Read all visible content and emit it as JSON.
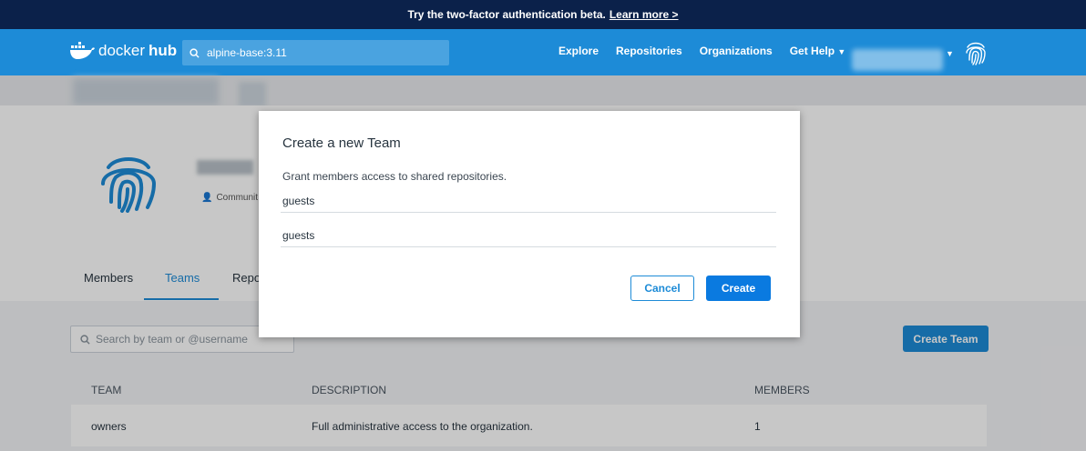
{
  "banner": {
    "text": "Try the two-factor authentication beta.",
    "link": "Learn more >"
  },
  "nav": {
    "logo_text_a": "docker",
    "logo_text_b": "hub",
    "search_value": "alpine-base:3.11",
    "links": [
      "Explore",
      "Repositories",
      "Organizations",
      "Get Help"
    ]
  },
  "org": {
    "type_label": "Communit"
  },
  "tabs": [
    "Members",
    "Teams",
    "Repos"
  ],
  "team_search": {
    "placeholder": "Search by team or @username"
  },
  "create_team_label": "Create Team",
  "table": {
    "headers": [
      "TEAM",
      "DESCRIPTION",
      "MEMBERS"
    ],
    "rows": [
      {
        "team": "owners",
        "description": "Full administrative access to the organization.",
        "members": "1"
      }
    ]
  },
  "modal": {
    "title": "Create a new Team",
    "description": "Grant members access to shared repositories.",
    "name_value": "guests",
    "description_value": "guests",
    "cancel_label": "Cancel",
    "create_label": "Create"
  }
}
